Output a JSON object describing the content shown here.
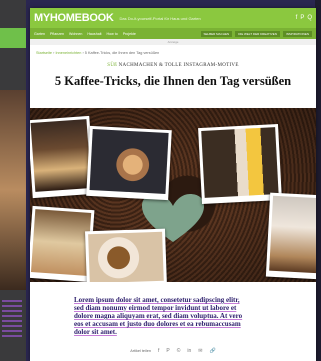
{
  "site": {
    "logo_prefix": "MY",
    "logo_main": "HOME",
    "logo_suffix": "BOOK",
    "tagline": "Das Do-it-yourself-Portal für Haus und Garten",
    "top_icons": [
      "f",
      "P",
      "Q"
    ]
  },
  "nav": {
    "items": [
      "Garten",
      "Pflanzen",
      "Wohnen",
      "Haushalt",
      "How to",
      "Projekte"
    ],
    "buttons": [
      "SELBER MACHEN",
      "DIE WELT DER KREATIVEN",
      "INSPIRATIONEN"
    ]
  },
  "ad_label": "Anzeige",
  "breadcrumb": {
    "home": "Startseite",
    "section": "Inneneinrichten",
    "current": "5 Kaffee-Tricks, die Ihnen den Tag versüßen"
  },
  "article": {
    "kicker_accent": "SÜß",
    "kicker_rest": " NACHMACHEN & TOLLE INSTAGRAM-MOTIVE",
    "headline": "5 Kaffee-Tricks, die Ihnen den Tag versüßen",
    "body_lines": [
      "Lorem ipsum dolor sit amet, consetetur sadipscing elitr,",
      "sed diam nonumy eirmod tempor invidunt ut labore et",
      "dolore magna aliquyam erat, sed diam voluptua. At vero",
      "eos et accusam et justo duo dolores et ea rebumaccusam",
      "dolor sit amet."
    ]
  },
  "share": {
    "label": "Artikel teilen",
    "icons": [
      "f",
      "P",
      "©",
      "in",
      "✉",
      "🔗"
    ]
  }
}
